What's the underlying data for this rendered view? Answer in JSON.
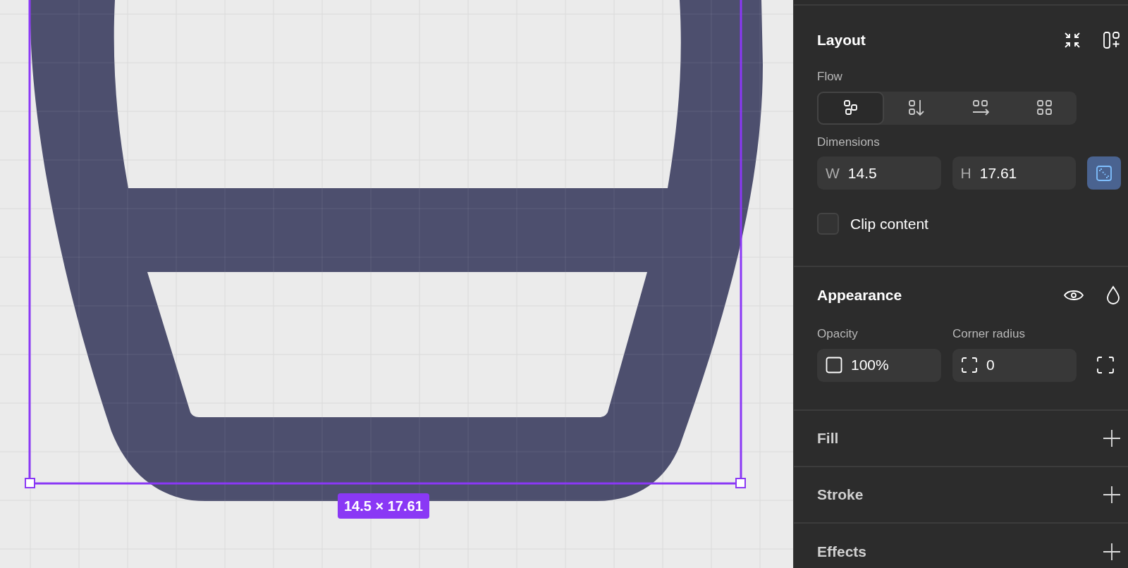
{
  "canvas": {
    "selection": {
      "label": "14.5 × 17.61"
    }
  },
  "panel": {
    "layout": {
      "title": "Layout",
      "flow": {
        "label": "Flow",
        "options": [
          {
            "selected": true
          },
          {
            "selected": false
          },
          {
            "selected": false
          },
          {
            "selected": false
          }
        ]
      },
      "dimensions": {
        "label": "Dimensions",
        "width": {
          "label": "W",
          "value": "14.5"
        },
        "height": {
          "label": "H",
          "value": "17.61"
        },
        "aspect_locked": true
      },
      "clip_content": {
        "label": "Clip content",
        "checked": false
      }
    },
    "appearance": {
      "title": "Appearance",
      "opacity": {
        "label": "Opacity",
        "value": "100%"
      },
      "corner_radius": {
        "label": "Corner radius",
        "value": "0"
      }
    },
    "sections": [
      {
        "title": "Fill"
      },
      {
        "title": "Stroke"
      },
      {
        "title": "Effects"
      }
    ]
  }
}
